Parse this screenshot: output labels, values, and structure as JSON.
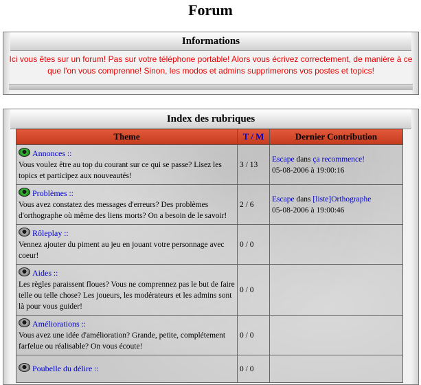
{
  "page": {
    "title": "Forum"
  },
  "info": {
    "title": "Informations",
    "text": "Ici vous êtes sur un forum! Pas sur votre téléphone portable! Alors vous écrivez correctement, de manière à ce que l'on vous comprenne! Sinon, les modos et admins supprimerons vos postes et topics!"
  },
  "index": {
    "title": "Index des rubriques",
    "headers": {
      "theme": "Theme",
      "tm": "T / M",
      "last": "Dernier Contribution"
    },
    "rows": [
      {
        "icon": "green-orb-icon",
        "name": "Annonces",
        "sep": " ::",
        "desc": "Vous voulez être au top du courant sur ce qui se passe? Lisez les topics et participez aux nouveautés!",
        "tm": "3 / 13",
        "last_user": "Escape",
        "last_in": " dans ",
        "last_topic": "ça recommence!",
        "last_date": "05-08-2006 à 19:00:16"
      },
      {
        "icon": "green-orb-icon",
        "name": "Problèmes",
        "sep": " ::",
        "desc": "Vous avez constatez des messages d'erreurs? Des problèmes d'orthographe où même des liens morts? On a besoin de le savoir!",
        "tm": "2 / 6",
        "last_user": "Escape",
        "last_in": " dans ",
        "last_topic": "[liste]Orthographe",
        "last_date": "05-08-2006 à 19:00:46"
      },
      {
        "icon": "grey-orb-icon",
        "name": "Rôleplay",
        "sep": " ::",
        "desc": "Vennez ajouter du piment au jeu en jouant votre personnage avec coeur!",
        "tm": "0 / 0"
      },
      {
        "icon": "grey-orb-icon",
        "name": "Aides",
        "sep": " ::",
        "desc": "Les règles paraissent floues? Vous ne comprennez pas le but de faire telle ou telle chose? Les joueurs, les modérateurs et les admins sont là pour vous guider!",
        "tm": "0 / 0"
      },
      {
        "icon": "grey-orb-icon",
        "name": "Améliorations",
        "sep": " ::",
        "desc": "Vous avez une idée d'amélioration? Grande, petite, complétement farfelue ou réalisable? On vous écoute!",
        "tm": "0 / 0"
      },
      {
        "icon": "grey-orb-icon",
        "name": "Poubelle du délire",
        "sep": " ::",
        "desc": "",
        "tm": "0 / 0"
      }
    ]
  }
}
